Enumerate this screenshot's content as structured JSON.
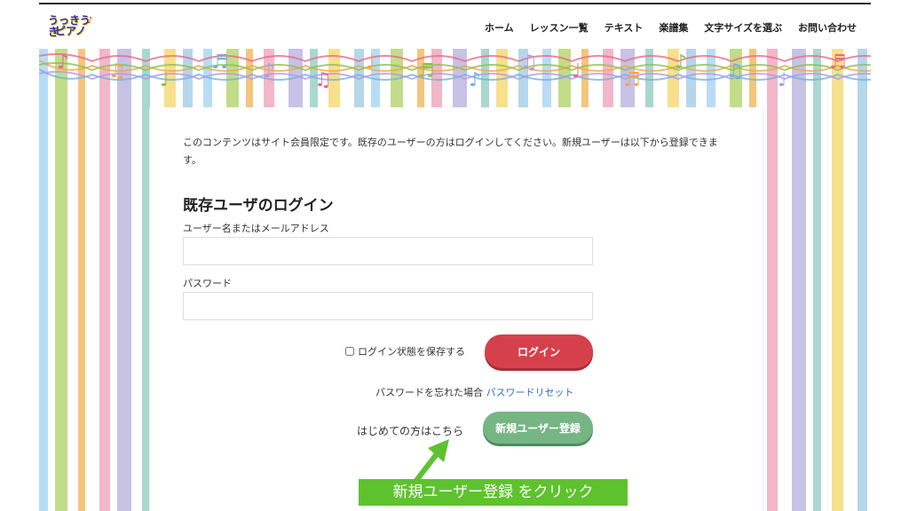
{
  "logo": {
    "line1": "うっきうき",
    "line2": "ピアノ",
    "note_glyph": "♪"
  },
  "nav": {
    "items": [
      {
        "label": "ホーム"
      },
      {
        "label": "レッスン一覧"
      },
      {
        "label": "テキスト"
      },
      {
        "label": "楽譜集"
      },
      {
        "label": "文字サイズを選ぶ"
      },
      {
        "label": "お問い合わせ"
      }
    ]
  },
  "content": {
    "intro": "このコンテンツはサイト会員限定です。既存のユーザーの方はログインしてください。新規ユーザーは以下から登録できます。",
    "heading": "既存ユーザのログイン",
    "username_label": "ユーザー名またはメールアドレス",
    "username_value": "",
    "password_label": "パスワード",
    "password_value": "",
    "remember_label": "ログイン状態を保存する",
    "remember_checked": false,
    "login_button": "ログイン",
    "forgot_text": "パスワードを忘れた場合",
    "forgot_link": "パスワードリセット",
    "first_time_text": "はじめての方はこちら",
    "register_button": "新規ユーザー登録"
  },
  "annotation": {
    "callout": "新規ユーザー登録 をクリック"
  },
  "colors": {
    "login_button": "#d6404c",
    "register_button": "#76b584",
    "callout": "#5ec22f",
    "link": "#2a6fc9",
    "stripes": [
      "#b9dcf5",
      "#c3dc8a",
      "#f3c67e",
      "#f2b7c9",
      "#c7c2e6",
      "#a9d8d0",
      "#f7e08c",
      "#b6d6ea"
    ]
  },
  "icons": {
    "arrow": "arrow-up-right-icon",
    "notes": "music-notes-icon"
  }
}
